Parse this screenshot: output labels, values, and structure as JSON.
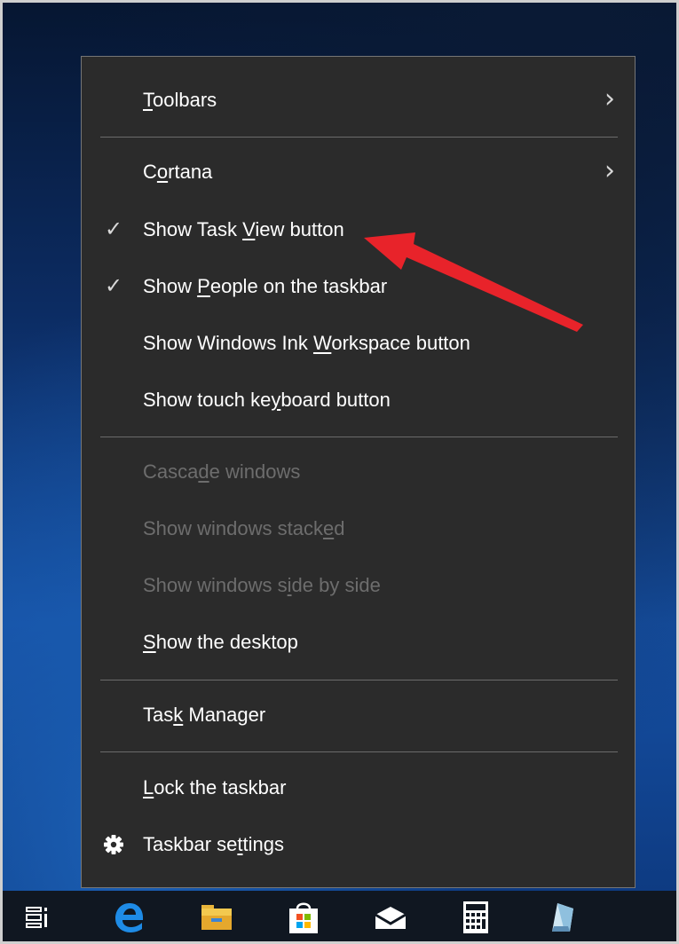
{
  "menu": {
    "items": [
      {
        "pre": "",
        "ul": "T",
        "post": "oolbars",
        "checked": false,
        "submenu": true,
        "disabled": false
      },
      {
        "pre": "C",
        "ul": "o",
        "post": "rtana",
        "checked": false,
        "submenu": true,
        "disabled": false
      },
      {
        "pre": "Show Task ",
        "ul": "V",
        "post": "iew button",
        "checked": true,
        "submenu": false,
        "disabled": false
      },
      {
        "pre": "Show ",
        "ul": "P",
        "post": "eople on the taskbar",
        "checked": true,
        "submenu": false,
        "disabled": false
      },
      {
        "pre": "Show Windows Ink ",
        "ul": "W",
        "post": "orkspace button",
        "checked": false,
        "submenu": false,
        "disabled": false
      },
      {
        "pre": "Show touch ke",
        "ul": "y",
        "post": "board button",
        "checked": false,
        "submenu": false,
        "disabled": false
      },
      {
        "pre": "Casca",
        "ul": "d",
        "post": "e windows",
        "checked": false,
        "submenu": false,
        "disabled": true
      },
      {
        "pre": "Show windows stack",
        "ul": "e",
        "post": "d",
        "checked": false,
        "submenu": false,
        "disabled": true
      },
      {
        "pre": "Show windows s",
        "ul": "i",
        "post": "de by side",
        "checked": false,
        "submenu": false,
        "disabled": true
      },
      {
        "pre": "",
        "ul": "S",
        "post": "how the desktop",
        "checked": false,
        "submenu": false,
        "disabled": false
      },
      {
        "pre": "Tas",
        "ul": "k",
        "post": " Manager",
        "checked": false,
        "submenu": false,
        "disabled": false
      },
      {
        "pre": "",
        "ul": "L",
        "post": "ock the taskbar",
        "checked": false,
        "submenu": false,
        "disabled": false
      },
      {
        "pre": "Taskbar se",
        "ul": "t",
        "post": "tings",
        "checked": false,
        "submenu": false,
        "disabled": false
      }
    ],
    "check_glyph": "✓",
    "submenu_glyph": "›"
  },
  "icons": {
    "checkmark": "checkmark-icon",
    "submenu": "chevron-right-icon",
    "settings": "gear-icon"
  },
  "taskbar": {
    "icons": [
      "task-view-icon",
      "edge-icon",
      "file-explorer-icon",
      "store-icon",
      "mail-icon",
      "calculator-icon",
      "app-icon"
    ]
  },
  "colors": {
    "menu_bg": "#2b2b2b",
    "text": "#ffffff",
    "disabled_text": "#6d6d6d",
    "arrow": "#e8232a",
    "taskbar_bg": "#101721",
    "running_indicator": "#9ec9f2"
  }
}
